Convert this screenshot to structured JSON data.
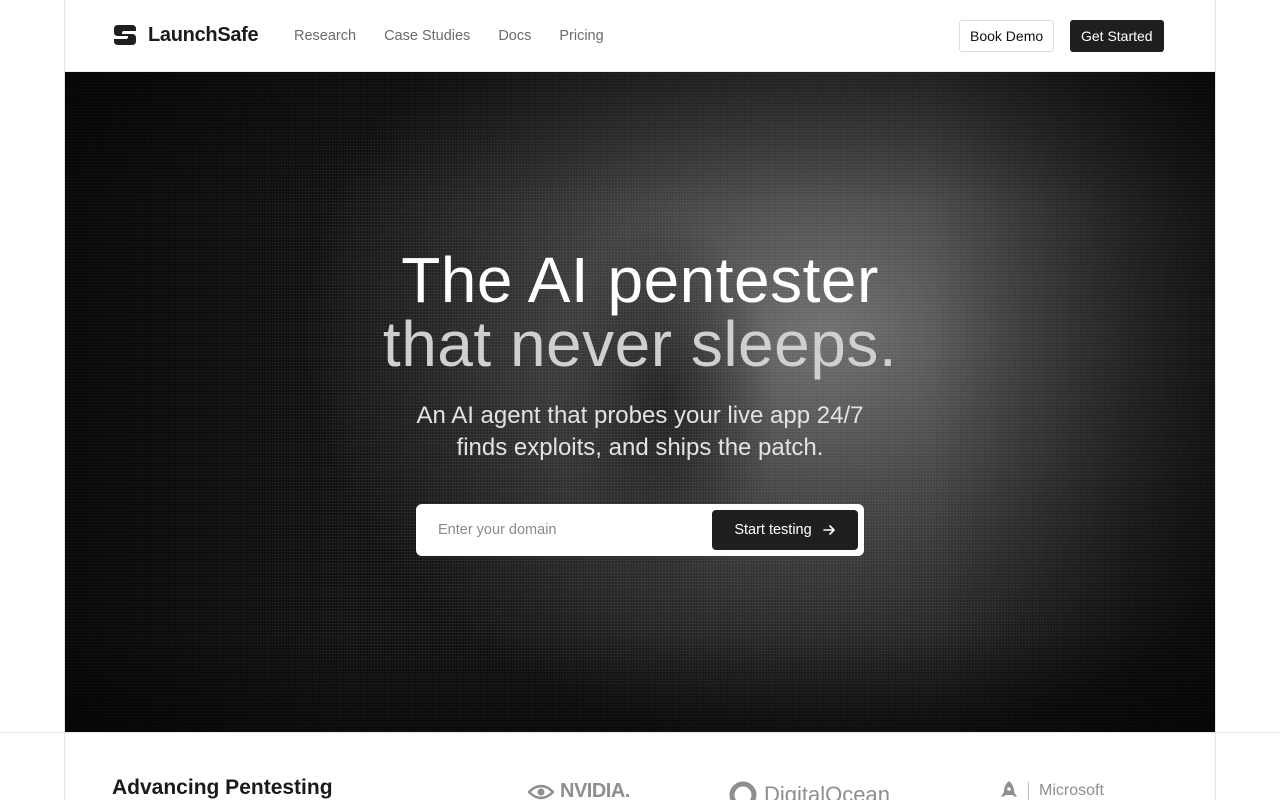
{
  "brand": {
    "name": "LaunchSafe"
  },
  "nav": {
    "items": [
      {
        "label": "Research"
      },
      {
        "label": "Case Studies"
      },
      {
        "label": "Docs"
      },
      {
        "label": "Pricing"
      }
    ]
  },
  "header_actions": {
    "book_demo": "Book Demo",
    "get_started": "Get Started"
  },
  "hero": {
    "headline_line1": "The AI pentester",
    "headline_line2": "that never sleeps.",
    "subtitle_line1": "An AI agent that probes your live app 24/7",
    "subtitle_line2": "finds exploits, and ships the patch.",
    "domain_placeholder": "Enter your domain",
    "cta_label": "Start testing"
  },
  "partners": {
    "title": "Advancing Pentesting",
    "logos": [
      "NVIDIA.",
      "DigitalOcean",
      "Microsoft"
    ]
  },
  "icons": {
    "logo": "launchsafe-s-mark",
    "cta": "arrow-right-icon",
    "nvidia": "nvidia-eye-icon",
    "digitalocean": "digitalocean-circle-icon",
    "microsoft": "rocket-icon"
  }
}
